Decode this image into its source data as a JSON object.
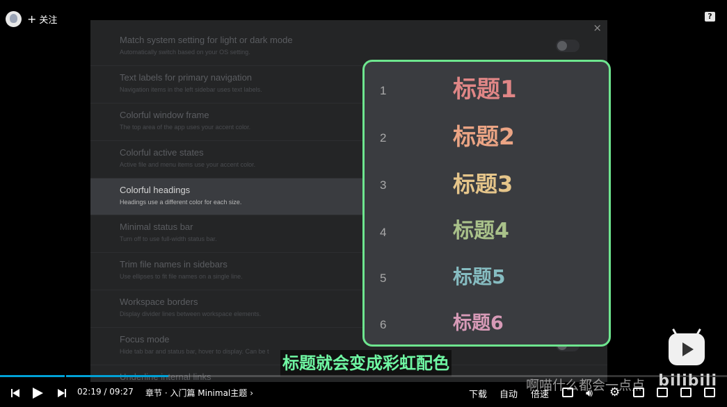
{
  "uploader": {
    "follow_plus": "+",
    "follow_label": "关注"
  },
  "help_label": "?",
  "settings": {
    "close_label": "×",
    "rows": [
      {
        "title": "Match system setting for light or dark mode",
        "desc": "Automatically switch based on your OS setting."
      },
      {
        "title": "Text labels for primary navigation",
        "desc": "Navigation items in the left sidebar uses text labels."
      },
      {
        "title": "Colorful window frame",
        "desc": "The top area of the app uses your accent color."
      },
      {
        "title": "Colorful active states",
        "desc": "Active file and menu items use your accent color."
      },
      {
        "title": "Colorful headings",
        "desc": "Headings use a different color for each size."
      },
      {
        "title": "Minimal status bar",
        "desc": "Turn off to use full-width status bar."
      },
      {
        "title": "Trim file names in sidebars",
        "desc": "Use ellipses to fit file names on a single line."
      },
      {
        "title": "Workspace borders",
        "desc": "Display divider lines between workspace elements."
      },
      {
        "title": "Focus mode",
        "desc": "Hide tab bar and status bar, hover to display. Can be t"
      },
      {
        "title": "Underline internal links",
        "desc": ""
      }
    ],
    "active_row": "Colorful headings"
  },
  "headings": {
    "accent_border": "#6ee68f",
    "items": [
      {
        "number": "1",
        "text": "标题1",
        "color": "#e08686"
      },
      {
        "number": "2",
        "text": "标题2",
        "color": "#eba484"
      },
      {
        "number": "3",
        "text": "标题3",
        "color": "#e5c58a"
      },
      {
        "number": "4",
        "text": "标题4",
        "color": "#a9c18a"
      },
      {
        "number": "5",
        "text": "标题5",
        "color": "#86bcc1"
      },
      {
        "number": "6",
        "text": "标题6",
        "color": "#d79ab7"
      }
    ]
  },
  "subtitle": {
    "text": "标题就会变成彩虹配色",
    "color": "#6ff7a3"
  },
  "watermark": {
    "text": "啊喵什么都会一点点",
    "brand": "bilibili"
  },
  "player": {
    "progress_fraction": 0.232,
    "accent": "#00a1d6",
    "current_time": "02:19",
    "time_sep": "/",
    "total_time": "09:27",
    "chapter": "章节 · 入门篇 Minimal主题",
    "chapter_arrow": "›",
    "download_label": "下载",
    "auto_label": "自动",
    "speed_label": "倍速"
  }
}
